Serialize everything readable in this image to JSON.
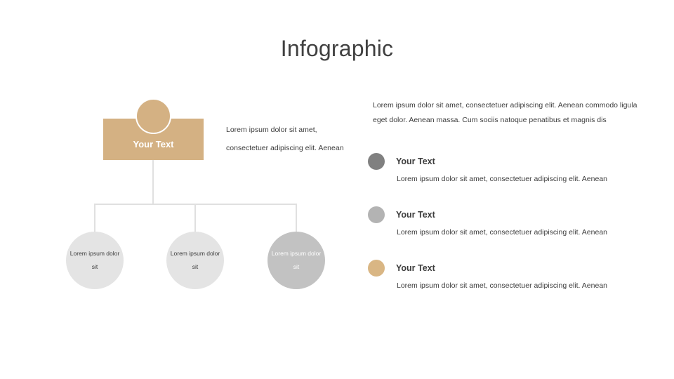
{
  "title": "Infographic",
  "colors": {
    "tan": "#d4b183",
    "tan_bullet": "#d9b684",
    "gray_dark_bullet": "#808080",
    "gray_light_bullet": "#b3b3b3",
    "leaf_light": "#e4e4e4",
    "leaf_dark": "#c2c2c2",
    "connector": "#e0e0e0",
    "text": "#3d3d3d",
    "title_text": "#404040"
  },
  "org_chart": {
    "root": {
      "label": "Your Text",
      "description": "Lorem ipsum dolor sit amet, consectetuer adipiscing elit. Aenean"
    },
    "leaves": [
      {
        "line1": "Lorem ipsum dolor",
        "line2": "sit",
        "fill": "#e4e4e4",
        "text_color": "#3d3d3d"
      },
      {
        "line1": "Lorem ipsum dolor",
        "line2": "sit",
        "fill": "#e4e4e4",
        "text_color": "#3d3d3d"
      },
      {
        "line1": "Lorem ipsum dolor",
        "line2": "sit",
        "fill": "#c2c2c2",
        "text_color": "#ffffff"
      }
    ]
  },
  "right_panel": {
    "intro": "Lorem ipsum dolor sit amet, consectetuer adipiscing elit. Aenean commodo ligula eget dolor. Aenean massa. Cum sociis natoque penatibus et magnis dis",
    "items": [
      {
        "title": "Your Text",
        "description": "Lorem ipsum dolor sit amet, consectetuer adipiscing elit. Aenean",
        "bullet_color": "#808080"
      },
      {
        "title": "Your Text",
        "description": "Lorem ipsum dolor sit amet, consectetuer adipiscing elit. Aenean",
        "bullet_color": "#b3b3b3"
      },
      {
        "title": "Your Text",
        "description": "Lorem ipsum dolor sit amet, consectetuer adipiscing elit. Aenean",
        "bullet_color": "#d9b684"
      }
    ]
  }
}
